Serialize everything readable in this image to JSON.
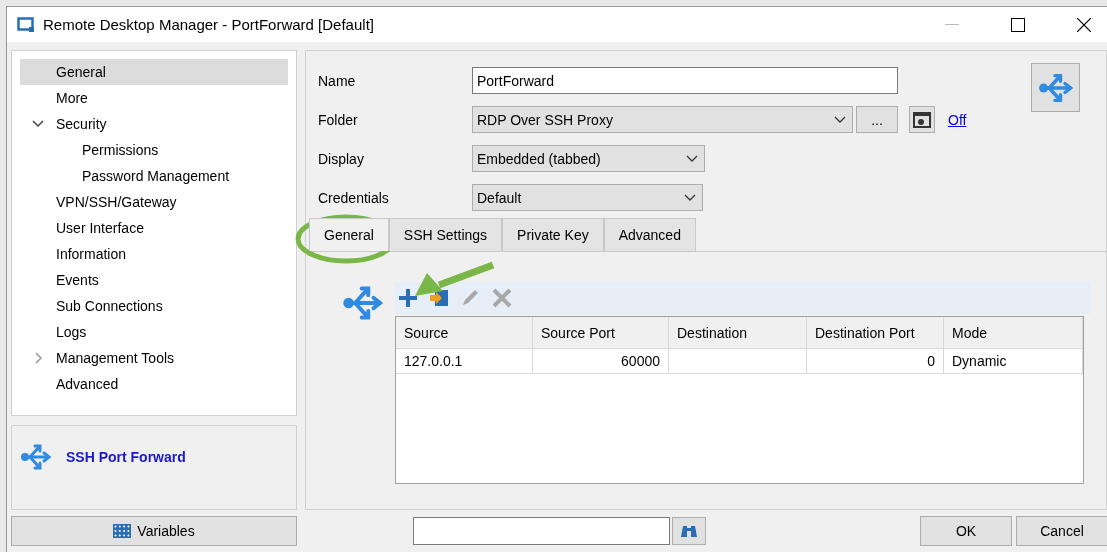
{
  "window": {
    "title": "Remote Desktop Manager - PortForward [Default]"
  },
  "sidebar": {
    "items": [
      {
        "label": "General",
        "selected": true
      },
      {
        "label": "More",
        "selected": false
      },
      {
        "label": "Security",
        "selected": false,
        "expanded": true,
        "children": [
          {
            "label": "Permissions",
            "selected": false
          },
          {
            "label": "Password Management",
            "selected": false
          }
        ]
      },
      {
        "label": "VPN/SSH/Gateway",
        "selected": false
      },
      {
        "label": "User Interface",
        "selected": false
      },
      {
        "label": "Information",
        "selected": false
      },
      {
        "label": "Events",
        "selected": false
      },
      {
        "label": "Sub Connections",
        "selected": false
      },
      {
        "label": "Logs",
        "selected": false
      },
      {
        "label": "Management Tools",
        "selected": false,
        "expanded": false
      },
      {
        "label": "Advanced",
        "selected": false
      }
    ]
  },
  "entry_type": {
    "label": "SSH Port Forward"
  },
  "variables_button": {
    "label": "Variables"
  },
  "form": {
    "fields": [
      {
        "label": "Name",
        "kind": "text",
        "value": "PortForward"
      },
      {
        "label": "Folder",
        "kind": "folder",
        "value": "RDP Over SSH Proxy",
        "more": "...",
        "link": "Off"
      },
      {
        "label": "Display",
        "kind": "combo",
        "value": "Embedded (tabbed)"
      },
      {
        "label": "Credentials",
        "kind": "combo",
        "value": "Default"
      }
    ]
  },
  "tabs": [
    {
      "label": "General",
      "selected": true
    },
    {
      "label": "SSH Settings",
      "selected": false
    },
    {
      "label": "Private Key",
      "selected": false
    },
    {
      "label": "Advanced",
      "selected": false
    }
  ],
  "toolbar": {
    "tools": [
      {
        "kind": "add",
        "disabled": false
      },
      {
        "kind": "import",
        "disabled": false
      },
      {
        "kind": "edit",
        "disabled": true
      },
      {
        "kind": "delete",
        "disabled": true
      }
    ]
  },
  "grid": {
    "columns": [
      {
        "label": "Source"
      },
      {
        "label": "Source Port"
      },
      {
        "label": "Destination"
      },
      {
        "label": "Destination Port"
      },
      {
        "label": "Mode"
      }
    ],
    "rows": [
      [
        "127.0.0.1",
        "60000",
        "",
        "0",
        "Dynamic"
      ]
    ]
  },
  "buttons": [
    "OK",
    "Cancel"
  ]
}
